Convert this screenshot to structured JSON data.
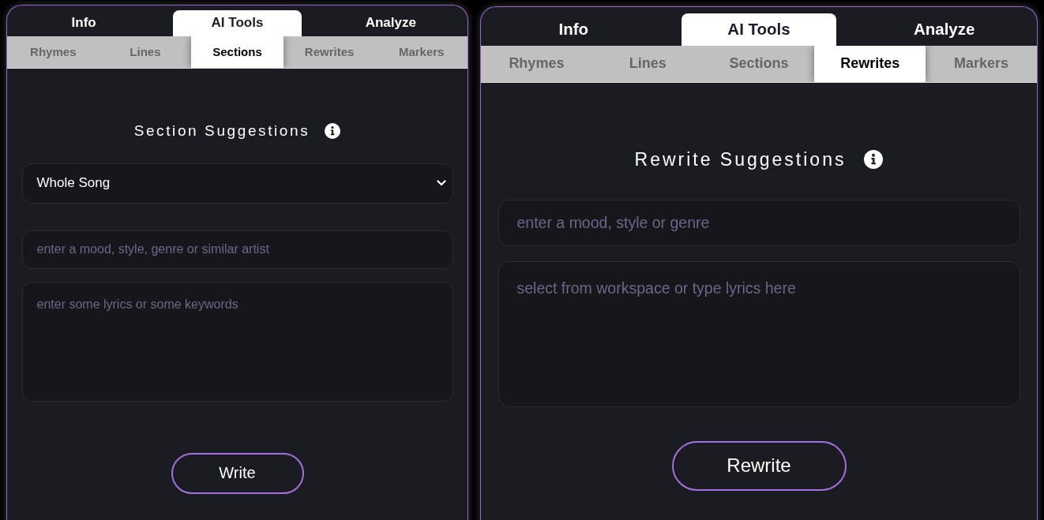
{
  "panels": [
    {
      "main_tabs": [
        {
          "label": "Info",
          "selected": false
        },
        {
          "label": "AI Tools",
          "selected": true
        },
        {
          "label": "Analyze",
          "selected": false
        }
      ],
      "sub_tabs": [
        {
          "label": "Rhymes",
          "selected": false
        },
        {
          "label": "Lines",
          "selected": false
        },
        {
          "label": "Sections",
          "selected": true
        },
        {
          "label": "Rewrites",
          "selected": false
        },
        {
          "label": "Markers",
          "selected": false
        }
      ],
      "heading": "Section Suggestions",
      "fields": [
        {
          "kind": "select",
          "value": "Whole Song"
        },
        {
          "kind": "input",
          "placeholder": "enter a mood, style, genre or similar artist"
        },
        {
          "kind": "textarea",
          "placeholder": "enter some lyrics or some keywords"
        }
      ],
      "button": "Write"
    },
    {
      "main_tabs": [
        {
          "label": "Info",
          "selected": false
        },
        {
          "label": "AI Tools",
          "selected": true
        },
        {
          "label": "Analyze",
          "selected": false
        }
      ],
      "sub_tabs": [
        {
          "label": "Rhymes",
          "selected": false
        },
        {
          "label": "Lines",
          "selected": false
        },
        {
          "label": "Sections",
          "selected": false
        },
        {
          "label": "Rewrites",
          "selected": true
        },
        {
          "label": "Markers",
          "selected": false
        }
      ],
      "heading": "Rewrite Suggestions",
      "fields": [
        {
          "kind": "input",
          "placeholder": "enter a mood, style or genre"
        },
        {
          "kind": "textarea",
          "placeholder": "select from workspace or type lyrics here"
        }
      ],
      "button": "Rewrite"
    }
  ]
}
